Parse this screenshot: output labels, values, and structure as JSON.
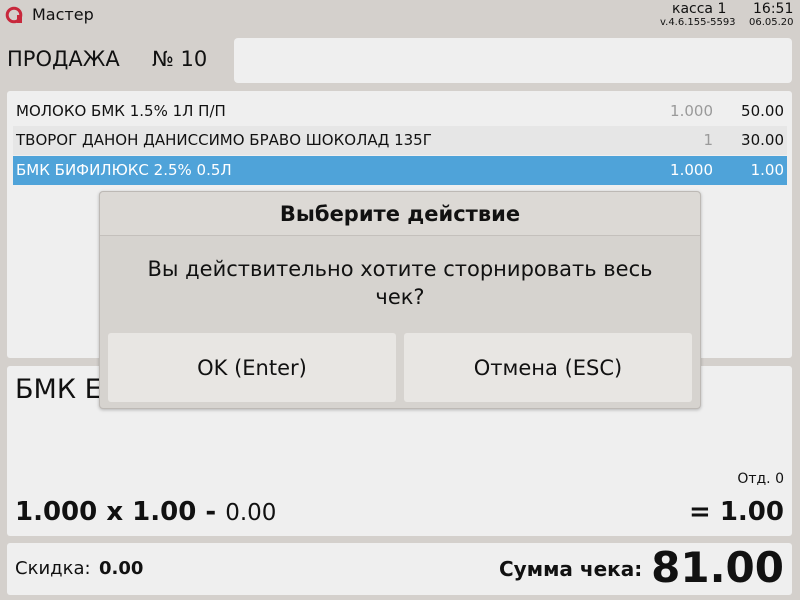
{
  "window": {
    "title": "Мастер"
  },
  "status": {
    "register": "касса 1",
    "time": "16:51",
    "version": "v.4.6.155-5593",
    "date": "06.05.20"
  },
  "sale": {
    "title": "ПРОДАЖА",
    "number": "№ 10"
  },
  "items": [
    {
      "name": "МОЛОКО БМК 1.5% 1Л П/П",
      "qty": "1.000",
      "price": "50.00"
    },
    {
      "name": "ТВОРОГ ДАНОН ДАНИССИМО БРАВО ШОКОЛАД 135Г",
      "qty": "1",
      "price": "30.00"
    },
    {
      "name": "БМК БИФИЛЮКС 2.5% 0.5Л",
      "qty": "1.000",
      "price": "1.00"
    }
  ],
  "selected_item_index": 2,
  "detail": {
    "name": "БМК Е",
    "department": "Отд. 0",
    "quantity": "1.000",
    "times": "x",
    "unit_price": "1.00",
    "minus": "-",
    "discount": "0.00",
    "equals": "=",
    "total": "1.00"
  },
  "footer": {
    "discount_label": "Скидка:",
    "discount_value": "0.00",
    "sum_label": "Сумма чека:",
    "sum_value": "81.00"
  },
  "dialog": {
    "title": "Выберите действие",
    "message": "Вы действительно хотите сторнировать весь чек?",
    "ok_label": "OK (Enter)",
    "cancel_label": "Отмена (ESC)"
  },
  "colors": {
    "selection": "#4fa3d9",
    "background": "#d4d0cc",
    "panel": "#efefef",
    "logo": "#c8283c"
  }
}
